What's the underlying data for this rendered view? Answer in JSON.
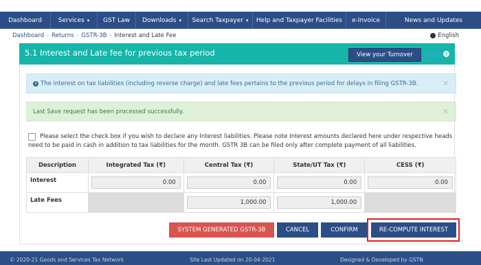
{
  "navbar": {
    "items": [
      {
        "label": "Dashboard",
        "caret": ""
      },
      {
        "label": "Services",
        "caret": "▾"
      },
      {
        "label": "GST Law",
        "caret": ""
      },
      {
        "label": "Downloads",
        "caret": "▾"
      },
      {
        "label": "Search Taxpayer",
        "caret": "▾"
      },
      {
        "label": "Help and Taxpayer Facilities",
        "caret": ""
      },
      {
        "label": "e-Invoice",
        "caret": ""
      },
      {
        "label": "News and Updates",
        "caret": ""
      }
    ]
  },
  "breadcrumb": {
    "items": [
      "Dashboard",
      "Returns",
      "GSTR-3B"
    ],
    "separator": "›",
    "current": "Interest and Late Fee"
  },
  "language": "English",
  "section": {
    "title": "5.1 Interest and Late fee for previous tax period",
    "turnover_button": "View your Turnover",
    "help_label": "Help",
    "help_icon": "?"
  },
  "alerts": {
    "info_icon": "i",
    "info_text": "The interest on tax liabilities (including reverse charge) and late fees pertains to the previous period for delays in filing GSTR-3B.",
    "success_text": "Last Save request has been processed successfully.",
    "close_glyph": "✕"
  },
  "declaration": {
    "text": "Please select the check box if you wish to declare any Interest liabilities. Please note Interest amounts declared here under respective heads need to be paid in cash in addition to tax liabilities for the month. GSTR 3B can be filed only after complete payment of all liabilities."
  },
  "table": {
    "headers": [
      "Description",
      "Integrated Tax (₹)",
      "Central Tax (₹)",
      "State/UT Tax (₹)",
      "CESS (₹)"
    ],
    "rows": [
      {
        "label": "Interest",
        "integrated": "0.00",
        "central": "0.00",
        "state": "0.00",
        "cess": "0.00"
      },
      {
        "label": "Late Fees",
        "central": "1,000.00",
        "state": "1,000.00"
      }
    ]
  },
  "buttons": {
    "system_generated": "SYSTEM GENERATED GSTR-3B",
    "cancel": "CANCEL",
    "confirm": "CONFIRM",
    "recompute": "RE-COMPUTE INTEREST"
  },
  "footer": {
    "copyright": "© 2020-21 Goods and Services Tax Network",
    "updated": "Site Last Updated on 20-04-2021",
    "designed": "Designed & Developed by GSTN"
  },
  "colors": {
    "nav": "#2c4e86",
    "teal": "#17b5a9",
    "danger": "#d9534f",
    "highlight": "#e02020"
  }
}
